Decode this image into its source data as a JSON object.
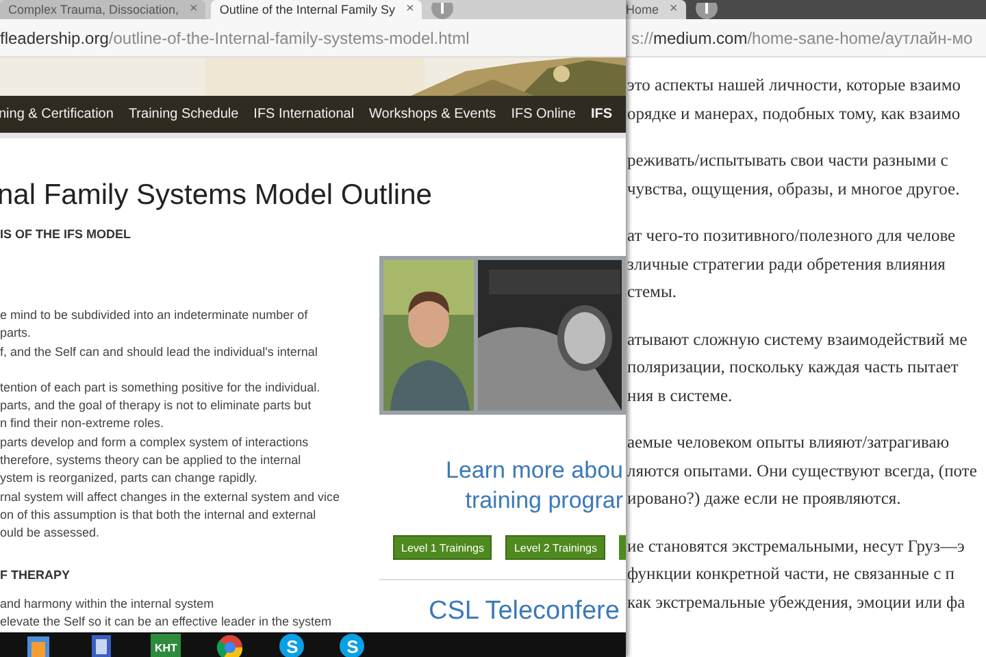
{
  "left_window": {
    "tabs": [
      {
        "title": "Complex Trauma, Dissociation,",
        "close": "×",
        "selected": false
      },
      {
        "title": "Outline of the Internal Family Sy",
        "close": "×",
        "selected": true
      }
    ],
    "address": {
      "host": "fleadership.org",
      "path": "/outline-of-the-Internal-family-systems-model.html"
    },
    "nav": [
      {
        "label": "ning & Certification",
        "bold": false
      },
      {
        "label": "Training Schedule",
        "bold": false
      },
      {
        "label": "IFS International",
        "bold": false
      },
      {
        "label": "Workshops & Events",
        "bold": false
      },
      {
        "label": "IFS Online",
        "bold": false
      },
      {
        "label": "IFS",
        "bold": true
      }
    ],
    "page": {
      "title": "nal Family Systems Model Outline",
      "sections": [
        {
          "heading": "IS OF THE IFS MODEL",
          "paragraphs": [
            [
              "e mind to be subdivided into an indeterminate number of",
              "parts.",
              "f, and the Self can and should lead the individual's internal"
            ],
            [
              "tention of each part is something positive for the individual.",
              "parts, and the goal of therapy is not to eliminate parts but",
              "n find their non-extreme roles.",
              "parts develop and form a complex system of interactions",
              "therefore, systems theory can be applied to the internal",
              "ystem is reorganized, parts can change rapidly.",
              "rnal system will affect changes in the external system and vice",
              "on of this assumption is that both the internal and external",
              "ould be assessed."
            ]
          ]
        },
        {
          "heading": "F THERAPY",
          "paragraphs": [
            [
              "and harmony within the internal system",
              "elevate the Self so it can be an effective leader in the system"
            ]
          ]
        }
      ]
    },
    "sidebar": {
      "podcast": {
        "kind": "picture"
      },
      "promo_lines": [
        "Learn more abou",
        "training prograr"
      ],
      "buttons": [
        "Level 1 Trainings",
        "Level 2 Trainings"
      ],
      "teleconference": "CSL Teleconfere"
    }
  },
  "right_window": {
    "tabs": [
      {
        "title": "Home",
        "close": "×",
        "selected": false
      }
    ],
    "address": {
      "scheme": "s://",
      "host": "medium.com",
      "path": "/home-sane-home/аутлайн-мо"
    },
    "paragraphs": [
      [
        "это аспекты нашей личности, которые взаимо",
        "орядке и манерах, подобных тому, как взаимо"
      ],
      [
        "реживать/испытывать свои части разными с",
        "чувства, ощущения, образы, и многое другое."
      ],
      [
        "ат чего-то позитивного/полезного для челове",
        "зличные стратегии ради обретения влияния",
        "стемы."
      ],
      [
        "атывают сложную систему взаимодействий ме",
        "поляризации, поскольку каждая часть пытает",
        "ния в системе."
      ],
      [
        "аемые человеком опыты влияют/затрагиваю",
        "ляются опытами. Они существуют всегда, (поте",
        "ировано?) даже если не проявляются."
      ],
      [
        "ие становятся экстремальными, несут Груз—э",
        "функции конкретной части, не связанные с п",
        "как экстремальные убеждения, эмоции или фа"
      ]
    ]
  },
  "taskbar": {
    "items": [
      {
        "kind": "file"
      },
      {
        "kind": "tablet"
      },
      {
        "kind": "kht",
        "label": "KHT"
      },
      {
        "kind": "browser"
      },
      {
        "kind": "skype",
        "label": "S"
      },
      {
        "kind": "skype",
        "label": "S"
      }
    ]
  }
}
